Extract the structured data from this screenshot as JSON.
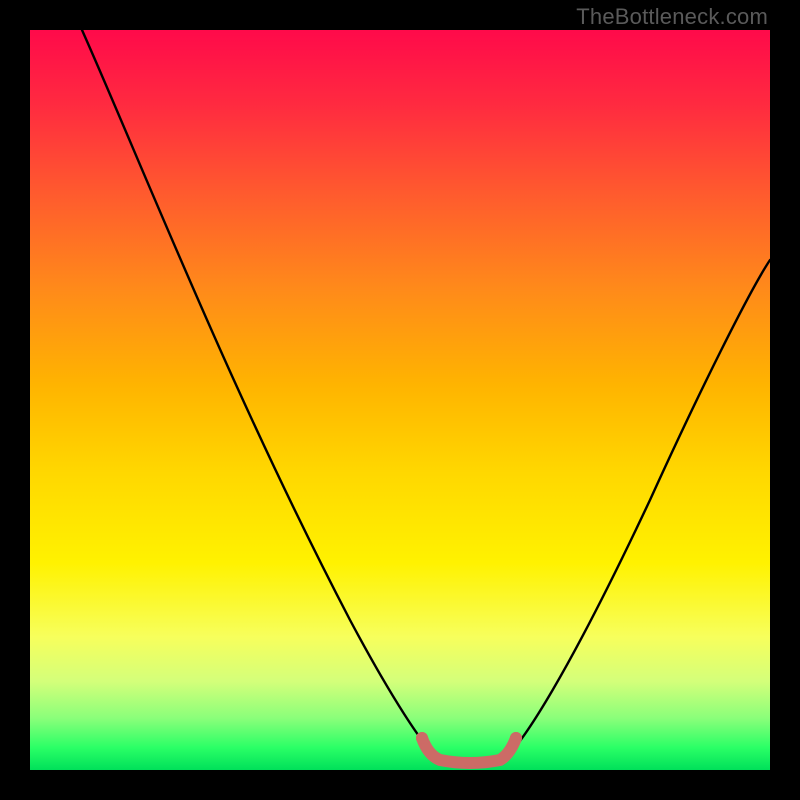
{
  "watermark": "TheBottleneck.com",
  "chart_data": {
    "type": "line",
    "title": "",
    "xlabel": "",
    "ylabel": "",
    "xlim": [
      0,
      100
    ],
    "ylim": [
      0,
      100
    ],
    "background": "rainbow-gradient (red top to green bottom)",
    "series": [
      {
        "name": "curve",
        "x": [
          7,
          12,
          18,
          24,
          30,
          36,
          42,
          47,
          51,
          54,
          56,
          58,
          60,
          62,
          64,
          68,
          74,
          80,
          86,
          92,
          98,
          100
        ],
        "y": [
          100,
          90,
          79,
          68,
          57,
          46,
          35,
          24,
          14,
          7,
          3,
          1,
          1,
          1,
          3,
          8,
          17,
          28,
          40,
          52,
          64,
          68
        ]
      },
      {
        "name": "valley-highlight",
        "color": "#cc6b66",
        "x": [
          53,
          55,
          57,
          59,
          61,
          63
        ],
        "y": [
          3.5,
          1.5,
          1,
          1,
          1.5,
          3.5
        ]
      }
    ]
  }
}
